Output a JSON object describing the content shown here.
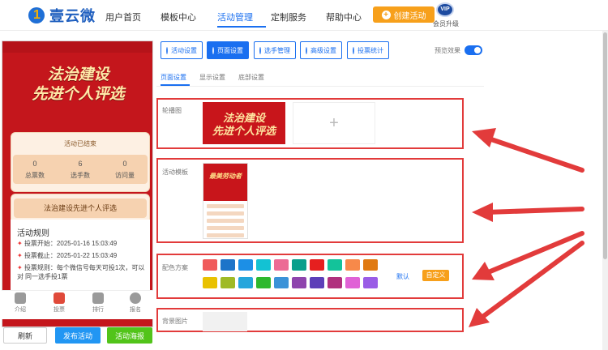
{
  "header": {
    "brand": "壹云微",
    "nav": [
      "用户首页",
      "模板中心",
      "活动管理",
      "定制服务",
      "帮助中心"
    ],
    "create_button": "创建活动",
    "vip_badge": "VIP",
    "vip_label": "会员升级"
  },
  "preview": {
    "banner_line1": "法治建设",
    "banner_line2": "先进个人评选",
    "status": "活动已结束",
    "stats": [
      {
        "value": "0",
        "label": "总票数"
      },
      {
        "value": "6",
        "label": "选手数"
      },
      {
        "value": "0",
        "label": "访问量"
      }
    ],
    "activity_name": "法治建设先进个人评选",
    "rules_title": "活动规则",
    "rules": [
      "投票开始：2025-01-16 15:03:49",
      "投票截止：2025-01-22 15:03:49",
      "投票规则：每个微信号每天可投1次，可以对",
      "同一选手投1票"
    ],
    "tabbar": [
      "介绍",
      "投票",
      "排行",
      "报名"
    ],
    "buttons": {
      "refresh": "刷新",
      "publish": "发布活动",
      "return": "活动海报"
    }
  },
  "settings": {
    "toolbar": [
      "活动设置",
      "页面设置",
      "选手管理",
      "高级设置",
      "投票统计"
    ],
    "preview_label": "预览效果",
    "subtabs": [
      "页面设置",
      "显示设置",
      "底部设置"
    ],
    "carousel_label": "轮播图",
    "carousel_image_line1": "法治建设",
    "carousel_image_line2": "先进个人评选",
    "add_symbol": "+",
    "template_label": "活动模板",
    "template_thumb_text": "最美劳动者",
    "color_label": "配色方案",
    "colors_row1": [
      "#f05b5b",
      "#1d74c9",
      "#1c8fe6",
      "#13c2d3",
      "#ec6b95",
      "#0a9f8c",
      "#e61f1f",
      "#13c39a",
      "#f7894a",
      "#e07a12"
    ],
    "colors_row2": [
      "#e9c100",
      "#9fba25",
      "#25a6dc",
      "#2eb82e",
      "#3a92d8",
      "#8e44ad",
      "#5d3fb8",
      "#b0307e",
      "#e062d6",
      "#9a5ce6"
    ],
    "default_label": "默认",
    "custom_label": "自定义",
    "bg_label": "背景图片"
  }
}
